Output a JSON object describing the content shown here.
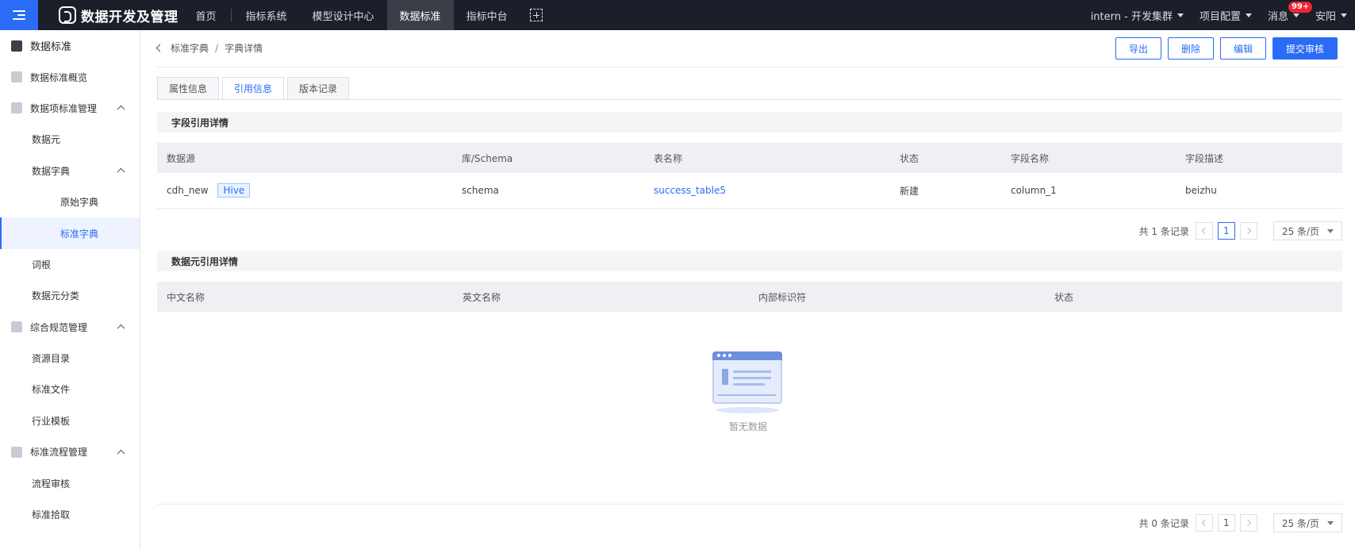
{
  "topbar": {
    "brand": "数据开发及管理",
    "nav": [
      "首页",
      "指标系统",
      "模型设计中心",
      "数据标准",
      "指标中台"
    ],
    "active_nav": "数据标准",
    "cluster": "intern - 开发集群",
    "project_config": "项目配置",
    "messages": "消息",
    "message_badge": "99+",
    "user": "安阳"
  },
  "sidebar": {
    "items": [
      {
        "label": "数据标准",
        "level": "root",
        "icon": "database-icon"
      },
      {
        "label": "数据标准概览",
        "level": "group",
        "icon": "dashboard-icon"
      },
      {
        "label": "数据项标准管理",
        "level": "group",
        "icon": "shield-icon",
        "expanded": true
      },
      {
        "label": "数据元",
        "level": "lvl1"
      },
      {
        "label": "数据字典",
        "level": "lvl1",
        "expanded": true
      },
      {
        "label": "原始字典",
        "level": "lvl2"
      },
      {
        "label": "标准字典",
        "level": "lvl2",
        "active": true
      },
      {
        "label": "词根",
        "level": "lvl1"
      },
      {
        "label": "数据元分类",
        "level": "lvl1"
      },
      {
        "label": "综合规范管理",
        "level": "group",
        "icon": "list-icon",
        "expanded": true
      },
      {
        "label": "资源目录",
        "level": "lvl1"
      },
      {
        "label": "标准文件",
        "level": "lvl1"
      },
      {
        "label": "行业模板",
        "level": "lvl1"
      },
      {
        "label": "标准流程管理",
        "level": "group",
        "icon": "flow-icon",
        "expanded": true
      },
      {
        "label": "流程审核",
        "level": "lvl1"
      },
      {
        "label": "标准拾取",
        "level": "lvl1"
      }
    ]
  },
  "breadcrumb": {
    "parent": "标准字典",
    "sep": "/",
    "current": "字典详情"
  },
  "actions": {
    "export": "导出",
    "delete": "删除",
    "edit": "编辑",
    "submit": "提交审核"
  },
  "tabs": [
    "属性信息",
    "引用信息",
    "版本记录"
  ],
  "active_tab": "引用信息",
  "field_refs": {
    "title": "字段引用详情",
    "columns": [
      "数据源",
      "库/Schema",
      "表名称",
      "状态",
      "字段名称",
      "字段描述"
    ],
    "rows": [
      {
        "source": "cdh_new",
        "tag": "Hive",
        "schema": "schema",
        "table": "success_table5",
        "status": "新建",
        "field": "column_1",
        "desc": "beizhu"
      }
    ],
    "pager": {
      "total": "共 1 条记录",
      "page": "1",
      "size": "25 条/页"
    }
  },
  "element_refs": {
    "title": "数据元引用详情",
    "columns": [
      "中文名称",
      "英文名称",
      "内部标识符",
      "状态"
    ],
    "empty": "暂无数据",
    "pager": {
      "total": "共 0 条记录",
      "page": "1",
      "size": "25 条/页"
    }
  },
  "colors": {
    "accent": "#2a6cf6",
    "topbar": "#1b1f2a"
  }
}
